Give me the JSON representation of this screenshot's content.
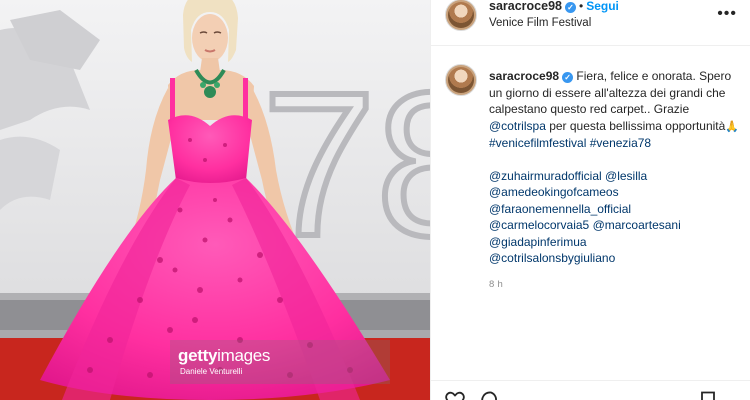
{
  "post": {
    "username": "saracroce98",
    "verified_glyph": "✓",
    "separator": "•",
    "follow_label": "Segui",
    "location": "Venice Film Festival",
    "more_glyph": "•••"
  },
  "caption": {
    "username": "saracroce98",
    "text_1": " Fiera, felice e onorata. Spero un giorno di essere all'altezza dei grandi che calpestano questo red carpet.. Grazie ",
    "mention_inline": "@cotrilspa",
    "text_2": " per questa bellissima opportunità",
    "emoji": "🙏",
    "hashtags": [
      "#venicefilmfestival",
      "#venezia78"
    ],
    "mentions": [
      "@zuhairmuradofficial",
      "@lesilla",
      "@amedeokingofcameos",
      "@faraonemennella_official",
      "@carmelocorvaia5",
      "@marcoartesani",
      "@giadapinferimua",
      "@cotrilsalonsbygiuliano"
    ],
    "time": "8 h"
  },
  "photo": {
    "backdrop_number": "78",
    "watermark_brand_bold": "getty",
    "watermark_brand_thin": "images",
    "watermark_credit": "Daniele Venturelli",
    "dress_color": "#ff2fa0",
    "carpet_color": "#c8261e"
  },
  "actions": {
    "like_icon": "heart-icon",
    "comment_icon": "comment-icon",
    "save_icon": "bookmark-icon"
  }
}
